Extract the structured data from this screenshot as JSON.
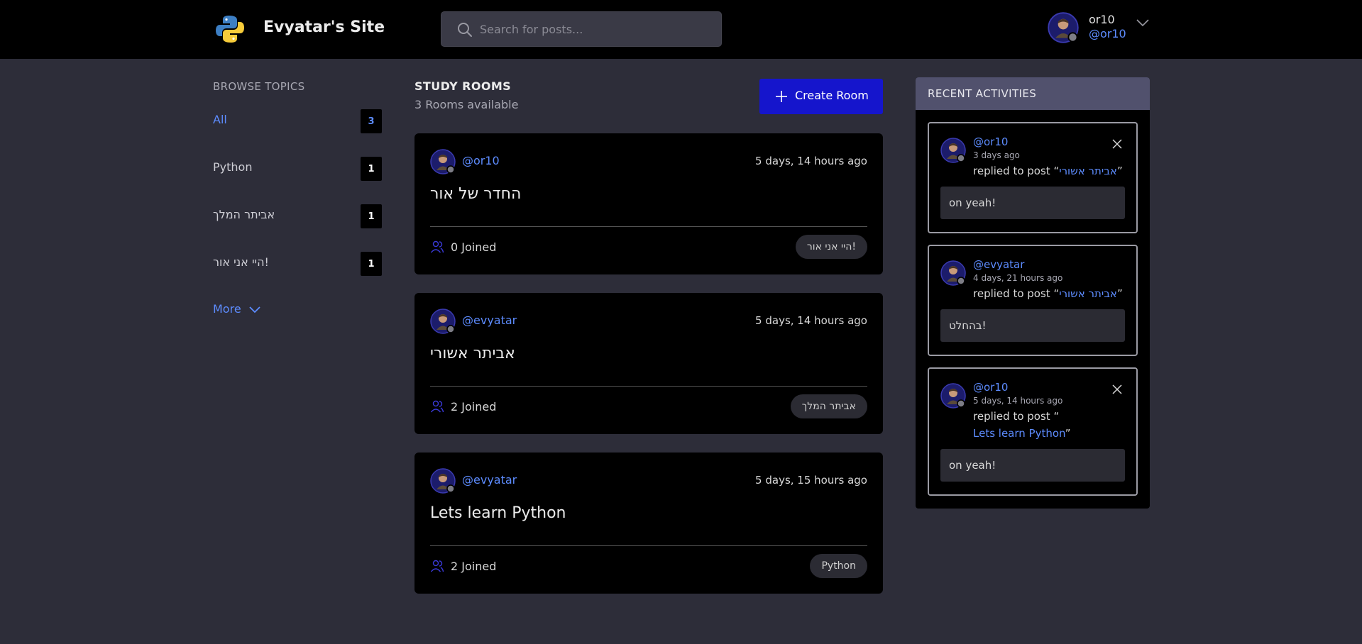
{
  "header": {
    "site_title": "Evyatar's Site",
    "search_placeholder": "Search for posts...",
    "user_name": "or10",
    "user_handle": "@or10"
  },
  "sidebar": {
    "heading": "BROWSE TOPICS",
    "topics": [
      {
        "label": "All",
        "count": "3",
        "active": true
      },
      {
        "label": "Python",
        "count": "1"
      },
      {
        "label": "אביתר המלך",
        "count": "1"
      },
      {
        "label": "היי אני אור!",
        "count": "1"
      }
    ],
    "more_label": "More"
  },
  "main": {
    "title": "STUDY ROOMS",
    "subtitle": "3 Rooms available",
    "create_label": "Create Room",
    "rooms": [
      {
        "host": "@or10",
        "time": "5 days, 14 hours ago",
        "name": "החדר של אור",
        "joined": "0 Joined",
        "topic": "היי אני אור!"
      },
      {
        "host": "@evyatar",
        "time": "5 days, 14 hours ago",
        "name": "אביתר אשורי",
        "joined": "2 Joined",
        "topic": "אביתר המלך"
      },
      {
        "host": "@evyatar",
        "time": "5 days, 15 hours ago",
        "name": "Lets learn Python",
        "joined": "2 Joined",
        "topic": "Python"
      }
    ]
  },
  "activities": {
    "title": "RECENT ACTIVITIES",
    "items": [
      {
        "user": "@or10",
        "time": "3 days ago",
        "action": "replied to post",
        "post": "אביתר אשורי",
        "reply": "on yeah!"
      },
      {
        "user": "@evyatar",
        "time": "4 days, 21 hours ago",
        "action": "replied to post",
        "post": "אביתר אשורי",
        "reply": "בהחלט!"
      },
      {
        "user": "@or10",
        "time": "5 days, 14 hours ago",
        "action": "replied to post",
        "post": "Lets learn Python",
        "reply": "on yeah!"
      }
    ]
  },
  "colors": {
    "accent": "#5d8cff",
    "primary_button": "#1515cc",
    "background": "#2d2d39",
    "card": "#000000",
    "activity_header": "#51516d"
  },
  "icons": [
    "python-logo",
    "search-icon",
    "chevron-down-icon",
    "plus-icon",
    "people-icon",
    "close-icon",
    "avatar"
  ]
}
